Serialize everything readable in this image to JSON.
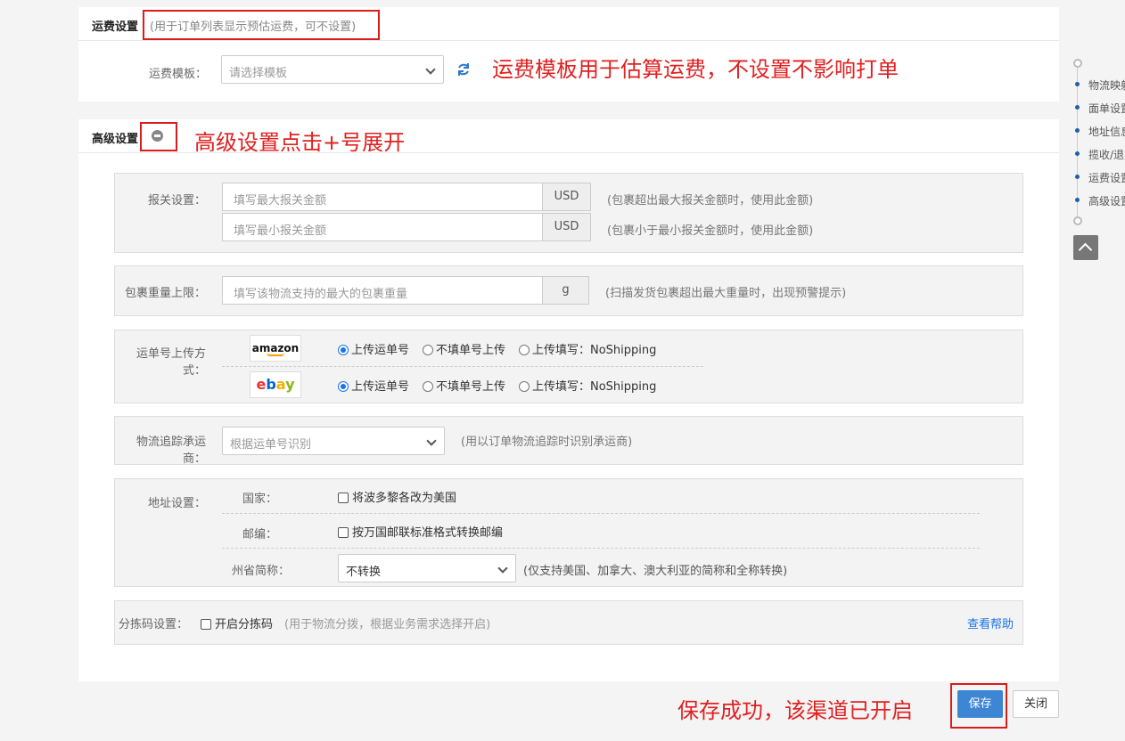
{
  "freight": {
    "title": "运费设置",
    "hint": "(用于订单列表显示预估运费，可不设置)",
    "template_label": "运费模板：",
    "template_placeholder": "请选择模板",
    "annotation": "运费模板用于估算运费，不设置不影响打单"
  },
  "advanced": {
    "title": "高级设置",
    "annotation": "高级设置点击+号展开",
    "customs": {
      "label": "报关设置：",
      "max_placeholder": "填写最大报关金额",
      "min_placeholder": "填写最小报关金额",
      "currency": "USD",
      "max_hint": "(包裹超出最大报关金额时，使用此金额)",
      "min_hint": "(包裹小于最小报关金额时，使用此金额)"
    },
    "weight": {
      "label": "包裹重量上限：",
      "placeholder": "填写该物流支持的最大的包裹重量",
      "unit": "g",
      "hint": "(扫描发货包裹超出最大重量时，出现预警提示)"
    },
    "tracking_upload": {
      "label": "运单号上传方式：",
      "platforms": [
        {
          "logo": "amazon",
          "options": [
            "上传运单号",
            "不填单号上传",
            "上传填写：NoShipping"
          ],
          "selected": 0
        },
        {
          "logo": "ebay",
          "options": [
            "上传运单号",
            "不填单号上传",
            "上传填写：NoShipping"
          ],
          "selected": 0
        }
      ]
    },
    "carrier": {
      "label": "物流追踪承运商：",
      "value": "根据运单号识别",
      "hint": "(用以订单物流追踪时识别承运商)"
    },
    "address": {
      "label": "地址设置：",
      "country_label": "国家：",
      "country_option": "将波多黎各改为美国",
      "zip_label": "邮编：",
      "zip_option": "按万国邮联标准格式转换邮编",
      "state_label": "州省简称：",
      "state_value": "不转换",
      "state_hint": "(仅支持美国、加拿大、澳大利亚的简称和全称转换)"
    },
    "sort_code": {
      "label": "分拣码设置：",
      "option": "开启分拣码",
      "hint": "(用于物流分拨，根据业务需求选择开启)",
      "help": "查看帮助"
    }
  },
  "footer": {
    "annotation": "保存成功，该渠道已开启",
    "save": "保存",
    "close": "关闭"
  },
  "side_nav": {
    "items": [
      "物流映射",
      "面单设置",
      "地址信息",
      "揽收/退货",
      "运费设置",
      "高级设置"
    ]
  },
  "colors": {
    "accent": "#1a73e8",
    "annotation_red": "#e02020",
    "save_button": "#3d86d4"
  }
}
